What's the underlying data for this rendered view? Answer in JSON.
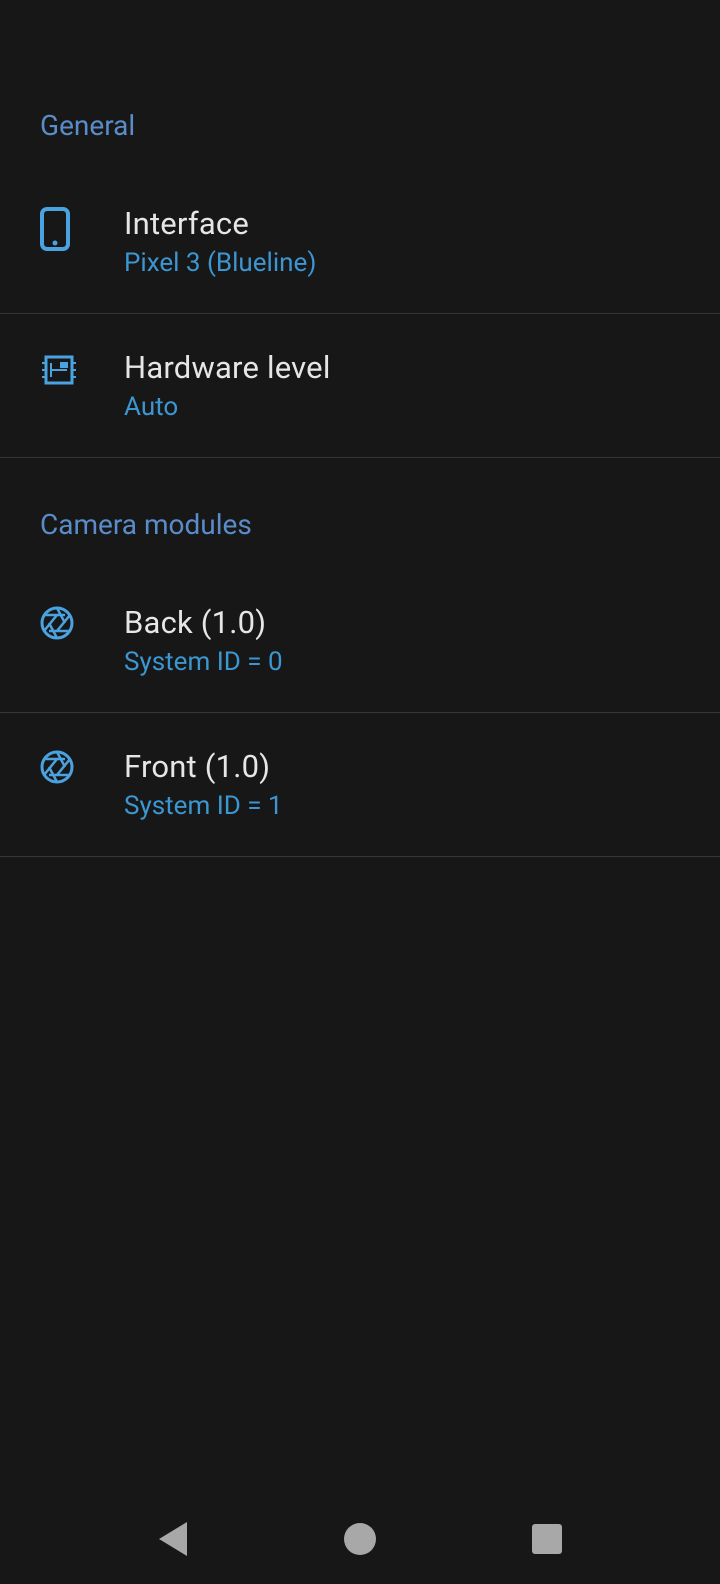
{
  "sections": {
    "general": {
      "header": "General",
      "interface": {
        "title": "Interface",
        "sub": "Pixel 3 (Blueline)"
      },
      "hardware": {
        "title": "Hardware level",
        "sub": "Auto"
      }
    },
    "camera": {
      "header": "Camera modules",
      "back": {
        "title": "Back  (1.0)",
        "sub": "System ID = 0"
      },
      "front": {
        "title": "Front  (1.0)",
        "sub": "System ID = 1"
      }
    }
  }
}
